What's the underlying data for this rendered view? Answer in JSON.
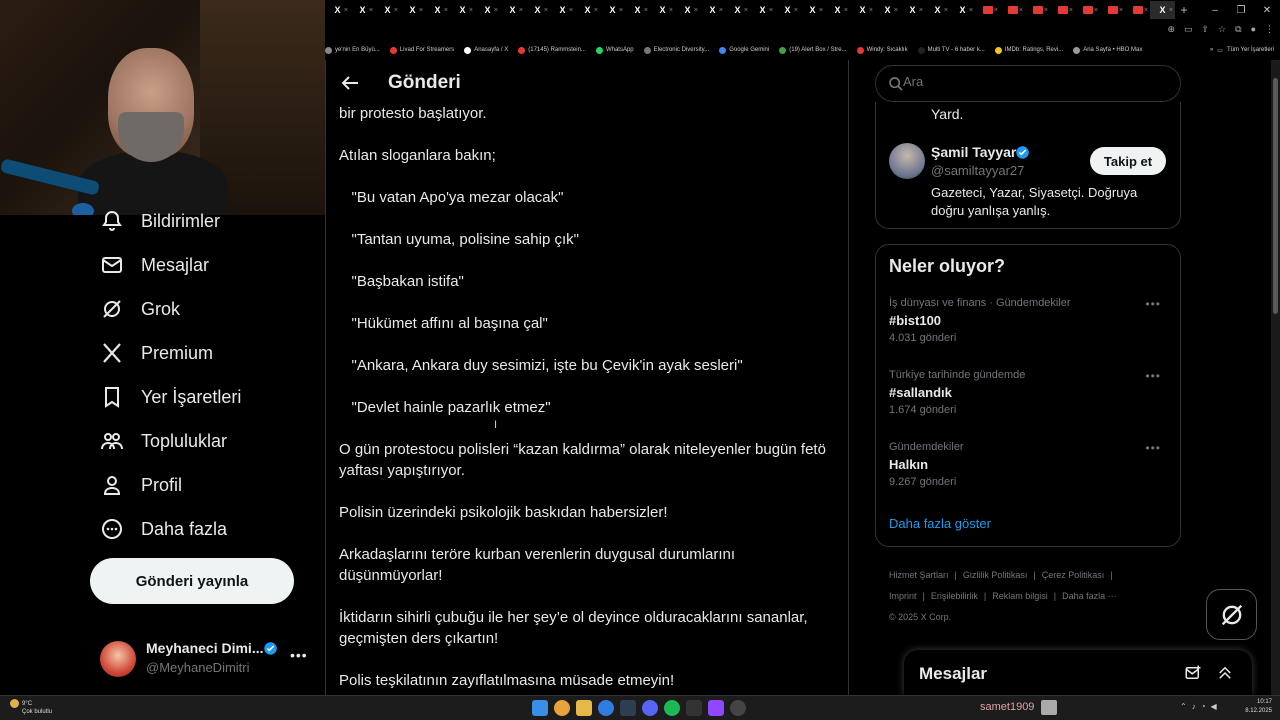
{
  "browser": {
    "tab_glyph": "X",
    "tab_close": "×",
    "new_tab": "+",
    "bookmarks": [
      {
        "label": "ye'nin En Büyü...",
        "color": "#888888"
      },
      {
        "label": "Livad For Streamers",
        "color": "#e53935"
      },
      {
        "label": "Anasayfa / X",
        "color": "#ffffff"
      },
      {
        "label": "(17145) Rammstein...",
        "color": "#e53935"
      },
      {
        "label": "WhatsApp",
        "color": "#25d366"
      },
      {
        "label": "Electronic Diversity...",
        "color": "#777777"
      },
      {
        "label": "Google Gemini",
        "color": "#4285f4"
      },
      {
        "label": "(19) Alert Box / Stre...",
        "color": "#43a047"
      },
      {
        "label": "Windy: Sıcaklık",
        "color": "#e53935"
      },
      {
        "label": "Multi TV - 6 haber k...",
        "color": "#222222"
      },
      {
        "label": "IMDb: Ratings, Revi...",
        "color": "#f5c518"
      },
      {
        "label": "Ana Sayfa • HBO Max",
        "color": "#999999"
      }
    ],
    "bookmarks_folder": "Tüm Yer İşaretleri"
  },
  "nav": {
    "items": [
      {
        "label": "Bildirimler",
        "icon": "bell-icon"
      },
      {
        "label": "Mesajlar",
        "icon": "envelope-icon"
      },
      {
        "label": "Grok",
        "icon": "grok-icon"
      },
      {
        "label": "Premium",
        "icon": "x-logo-icon"
      },
      {
        "label": "Yer İşaretleri",
        "icon": "bookmark-icon"
      },
      {
        "label": "Topluluklar",
        "icon": "people-icon"
      },
      {
        "label": "Profil",
        "icon": "person-icon"
      },
      {
        "label": "Daha fazla",
        "icon": "more-circle-icon"
      }
    ],
    "post_button": "Gönderi yayınla",
    "account": {
      "name": "Meyhaneci Dimi...",
      "handle": "@MeyhaneDimitri",
      "more": "•••"
    }
  },
  "main": {
    "title": "Gönderi",
    "paragraphs": [
      "bir protesto başlatıyor.",
      "Atılan sloganlara bakın;",
      "   \"Bu vatan Apo'ya mezar olacak\"",
      "   \"Tantan uyuma, polisine sahip çık\"",
      "   \"Başbakan istifa\"",
      "   \"Hükümet affını al başına çal\"",
      "   \"Ankara, Ankara duy sesimizi, işte bu Çevik'in ayak sesleri\"",
      "   \"Devlet hainle pazarlık etmez\"",
      "O gün protestocu polisleri “kazan kaldırma” olarak niteleyenler bugün fetö yaftası yapıştırıyor.",
      "Polisin üzerindeki psikolojik baskıdan habersizler!",
      "Arkadaşlarını teröre kurban verenlerin duygusal durumlarını düşünmüyorlar!",
      "İktidarın sihirli çubuğu ile her şey’e ol deyince olduracaklarını sananlar, geçmişten ders çıkartın!",
      "Polis teşkilatının zayıflatılmasına müsade etmeyin!"
    ]
  },
  "right": {
    "search_placeholder": "Ara",
    "prev_suggestion_tail": "Yard.",
    "suggestion": {
      "name": "Şamil Tayyar",
      "handle": "@samiltayyar27",
      "bio": "Gazeteci, Yazar, Siyasetçi. Doğruya doğru yanlışa yanlış.",
      "follow": "Takip et"
    },
    "trends_title": "Neler oluyor?",
    "trends": [
      {
        "category": "İş dünyası ve finans · Gündemdekiler",
        "name": "#bist100",
        "count": "4.031 gönderi"
      },
      {
        "category": "Türkiye tarihinde gündemde",
        "name": "#sallandık",
        "count": "1.674 gönderi"
      },
      {
        "category": "Gündemdekiler",
        "name": "Halkın",
        "count": "9.267 gönderi"
      }
    ],
    "trend_more": "•••",
    "show_more": "Daha fazla göster",
    "footer": [
      "Hizmet Şartları",
      "|",
      "Gizlilik Politikası",
      "|",
      "Çerez Politikası",
      "|",
      "Imprint",
      "|",
      "Erişilebilirlik",
      "|",
      "Reklam bilgisi",
      "|",
      "Daha fazla ···",
      "© 2025 X Corp."
    ],
    "messages_drawer": "Mesajlar"
  },
  "taskbar": {
    "weather_temp": "9°C",
    "weather_desc": "Çok bulutlu",
    "user": "samet1909",
    "time": "10:17",
    "date": "8.12.2025"
  },
  "colors": {
    "accent": "#1d9bf0",
    "background": "#000000",
    "border": "#2f3336",
    "muted": "#71767b"
  }
}
